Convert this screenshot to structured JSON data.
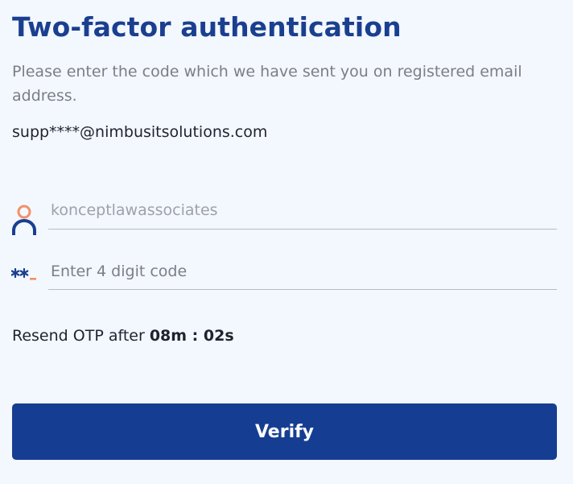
{
  "title": "Two-factor authentication",
  "subtitle": "Please enter the code which we have sent you on registered email address.",
  "email": "supp****@nimbusitsolutions.com",
  "username_field": {
    "value": "konceptlawassociates",
    "icon": "user-icon"
  },
  "code_field": {
    "placeholder": "Enter 4 digit code",
    "icon": "password-icon"
  },
  "resend": {
    "label": "Resend OTP after ",
    "timer": "08m : 02s"
  },
  "verify_label": "Verify",
  "colors": {
    "primary": "#153e92",
    "accent": "#f0916a",
    "background": "#f3f7fe",
    "muted_text": "#7b7e89"
  }
}
